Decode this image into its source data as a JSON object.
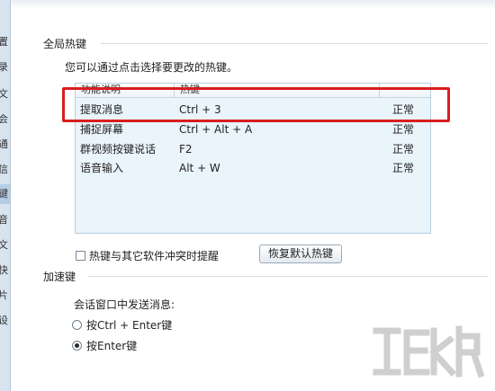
{
  "sidebar": {
    "items": [
      "置",
      "录",
      "文",
      "会",
      "通",
      "信",
      "键",
      "音",
      "文",
      "快",
      "片",
      "设"
    ]
  },
  "hotkeys": {
    "section_title": "全局热键",
    "hint": "您可以通过点击选择要更改的热键。",
    "columns": [
      "功能说明",
      "热键",
      ""
    ],
    "rows": [
      {
        "name": "提取消息",
        "key": "Ctrl + 3",
        "status": "正常"
      },
      {
        "name": "捕捉屏幕",
        "key": "Ctrl + Alt + A",
        "status": "正常"
      },
      {
        "name": "群视频按键说话",
        "key": "F2",
        "status": "正常"
      },
      {
        "name": "语音输入",
        "key": "Alt + W",
        "status": "正常"
      }
    ],
    "conflict_label": "热键与其它软件冲突时提醒",
    "restore_label": "恢复默认热键"
  },
  "accelerator": {
    "section_title": "加速键",
    "sub_label": "会话窗口中发送消息:",
    "options": [
      {
        "label": "按Ctrl + Enter键",
        "selected": false
      },
      {
        "label": "按Enter键",
        "selected": true
      }
    ]
  },
  "colors": {
    "highlight": "#d81e1e",
    "table_bg": "#eaf4fb"
  }
}
